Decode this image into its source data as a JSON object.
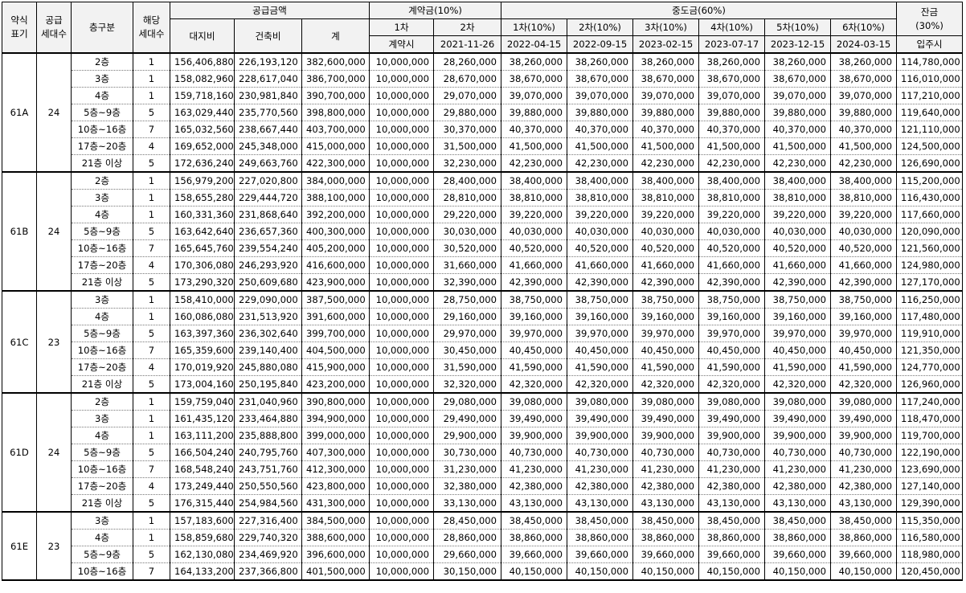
{
  "header": {
    "type_label": "약식\n표기",
    "supply_units_label": "공급\n세대수",
    "floor_label": "층구분",
    "count_label": "해당\n세대수",
    "supply_price_group": "공급금액",
    "land_label": "대지비",
    "building_label": "건축비",
    "total_label": "계",
    "deposit_group": "계약금(10%)",
    "deposit_1": "1차",
    "deposit_2": "2차",
    "deposit_1_date": "계약시",
    "deposit_2_date": "2021-11-26",
    "interim_group": "중도금(60%)",
    "interim": [
      {
        "label": "1차(10%)",
        "date": "2022-04-15"
      },
      {
        "label": "2차(10%)",
        "date": "2022-09-15"
      },
      {
        "label": "3차(10%)",
        "date": "2023-02-15"
      },
      {
        "label": "4차(10%)",
        "date": "2023-07-17"
      },
      {
        "label": "5차(10%)",
        "date": "2023-12-15"
      },
      {
        "label": "6차(10%)",
        "date": "2024-03-15"
      }
    ],
    "balance_label": "잔금\n(30%)",
    "balance_date": "입주시"
  },
  "groups": [
    {
      "type": "61A",
      "units": "24",
      "rows": [
        {
          "floor": "2층",
          "count": "1",
          "land": "156,406,880",
          "building": "226,193,120",
          "total": "382,600,000",
          "dep1": "10,000,000",
          "dep2": "28,260,000",
          "interim": "38,260,000",
          "balance": "114,780,000"
        },
        {
          "floor": "3층",
          "count": "1",
          "land": "158,082,960",
          "building": "228,617,040",
          "total": "386,700,000",
          "dep1": "10,000,000",
          "dep2": "28,670,000",
          "interim": "38,670,000",
          "balance": "116,010,000"
        },
        {
          "floor": "4층",
          "count": "1",
          "land": "159,718,160",
          "building": "230,981,840",
          "total": "390,700,000",
          "dep1": "10,000,000",
          "dep2": "29,070,000",
          "interim": "39,070,000",
          "balance": "117,210,000"
        },
        {
          "floor": "5층~9층",
          "count": "5",
          "land": "163,029,440",
          "building": "235,770,560",
          "total": "398,800,000",
          "dep1": "10,000,000",
          "dep2": "29,880,000",
          "interim": "39,880,000",
          "balance": "119,640,000"
        },
        {
          "floor": "10층~16층",
          "count": "7",
          "land": "165,032,560",
          "building": "238,667,440",
          "total": "403,700,000",
          "dep1": "10,000,000",
          "dep2": "30,370,000",
          "interim": "40,370,000",
          "balance": "121,110,000"
        },
        {
          "floor": "17층~20층",
          "count": "4",
          "land": "169,652,000",
          "building": "245,348,000",
          "total": "415,000,000",
          "dep1": "10,000,000",
          "dep2": "31,500,000",
          "interim": "41,500,000",
          "balance": "124,500,000"
        },
        {
          "floor": "21층 이상",
          "count": "5",
          "land": "172,636,240",
          "building": "249,663,760",
          "total": "422,300,000",
          "dep1": "10,000,000",
          "dep2": "32,230,000",
          "interim": "42,230,000",
          "balance": "126,690,000"
        }
      ]
    },
    {
      "type": "61B",
      "units": "24",
      "rows": [
        {
          "floor": "2층",
          "count": "1",
          "land": "156,979,200",
          "building": "227,020,800",
          "total": "384,000,000",
          "dep1": "10,000,000",
          "dep2": "28,400,000",
          "interim": "38,400,000",
          "balance": "115,200,000"
        },
        {
          "floor": "3층",
          "count": "1",
          "land": "158,655,280",
          "building": "229,444,720",
          "total": "388,100,000",
          "dep1": "10,000,000",
          "dep2": "28,810,000",
          "interim": "38,810,000",
          "balance": "116,430,000"
        },
        {
          "floor": "4층",
          "count": "1",
          "land": "160,331,360",
          "building": "231,868,640",
          "total": "392,200,000",
          "dep1": "10,000,000",
          "dep2": "29,220,000",
          "interim": "39,220,000",
          "balance": "117,660,000"
        },
        {
          "floor": "5층~9층",
          "count": "5",
          "land": "163,642,640",
          "building": "236,657,360",
          "total": "400,300,000",
          "dep1": "10,000,000",
          "dep2": "30,030,000",
          "interim": "40,030,000",
          "balance": "120,090,000"
        },
        {
          "floor": "10층~16층",
          "count": "7",
          "land": "165,645,760",
          "building": "239,554,240",
          "total": "405,200,000",
          "dep1": "10,000,000",
          "dep2": "30,520,000",
          "interim": "40,520,000",
          "balance": "121,560,000"
        },
        {
          "floor": "17층~20층",
          "count": "4",
          "land": "170,306,080",
          "building": "246,293,920",
          "total": "416,600,000",
          "dep1": "10,000,000",
          "dep2": "31,660,000",
          "interim": "41,660,000",
          "balance": "124,980,000"
        },
        {
          "floor": "21층 이상",
          "count": "5",
          "land": "173,290,320",
          "building": "250,609,680",
          "total": "423,900,000",
          "dep1": "10,000,000",
          "dep2": "32,390,000",
          "interim": "42,390,000",
          "balance": "127,170,000"
        }
      ]
    },
    {
      "type": "61C",
      "units": "23",
      "rows": [
        {
          "floor": "3층",
          "count": "1",
          "land": "158,410,000",
          "building": "229,090,000",
          "total": "387,500,000",
          "dep1": "10,000,000",
          "dep2": "28,750,000",
          "interim": "38,750,000",
          "balance": "116,250,000"
        },
        {
          "floor": "4층",
          "count": "1",
          "land": "160,086,080",
          "building": "231,513,920",
          "total": "391,600,000",
          "dep1": "10,000,000",
          "dep2": "29,160,000",
          "interim": "39,160,000",
          "balance": "117,480,000"
        },
        {
          "floor": "5층~9층",
          "count": "5",
          "land": "163,397,360",
          "building": "236,302,640",
          "total": "399,700,000",
          "dep1": "10,000,000",
          "dep2": "29,970,000",
          "interim": "39,970,000",
          "balance": "119,910,000"
        },
        {
          "floor": "10층~16층",
          "count": "7",
          "land": "165,359,600",
          "building": "239,140,400",
          "total": "404,500,000",
          "dep1": "10,000,000",
          "dep2": "30,450,000",
          "interim": "40,450,000",
          "balance": "121,350,000"
        },
        {
          "floor": "17층~20층",
          "count": "4",
          "land": "170,019,920",
          "building": "245,880,080",
          "total": "415,900,000",
          "dep1": "10,000,000",
          "dep2": "31,590,000",
          "interim": "41,590,000",
          "balance": "124,770,000"
        },
        {
          "floor": "21층 이상",
          "count": "5",
          "land": "173,004,160",
          "building": "250,195,840",
          "total": "423,200,000",
          "dep1": "10,000,000",
          "dep2": "32,320,000",
          "interim": "42,320,000",
          "balance": "126,960,000"
        }
      ]
    },
    {
      "type": "61D",
      "units": "24",
      "rows": [
        {
          "floor": "2층",
          "count": "1",
          "land": "159,759,040",
          "building": "231,040,960",
          "total": "390,800,000",
          "dep1": "10,000,000",
          "dep2": "29,080,000",
          "interim": "39,080,000",
          "balance": "117,240,000"
        },
        {
          "floor": "3층",
          "count": "1",
          "land": "161,435,120",
          "building": "233,464,880",
          "total": "394,900,000",
          "dep1": "10,000,000",
          "dep2": "29,490,000",
          "interim": "39,490,000",
          "balance": "118,470,000"
        },
        {
          "floor": "4층",
          "count": "1",
          "land": "163,111,200",
          "building": "235,888,800",
          "total": "399,000,000",
          "dep1": "10,000,000",
          "dep2": "29,900,000",
          "interim": "39,900,000",
          "balance": "119,700,000"
        },
        {
          "floor": "5층~9층",
          "count": "5",
          "land": "166,504,240",
          "building": "240,795,760",
          "total": "407,300,000",
          "dep1": "10,000,000",
          "dep2": "30,730,000",
          "interim": "40,730,000",
          "balance": "122,190,000"
        },
        {
          "floor": "10층~16층",
          "count": "7",
          "land": "168,548,240",
          "building": "243,751,760",
          "total": "412,300,000",
          "dep1": "10,000,000",
          "dep2": "31,230,000",
          "interim": "41,230,000",
          "balance": "123,690,000"
        },
        {
          "floor": "17층~20층",
          "count": "4",
          "land": "173,249,440",
          "building": "250,550,560",
          "total": "423,800,000",
          "dep1": "10,000,000",
          "dep2": "32,380,000",
          "interim": "42,380,000",
          "balance": "127,140,000"
        },
        {
          "floor": "21층 이상",
          "count": "5",
          "land": "176,315,440",
          "building": "254,984,560",
          "total": "431,300,000",
          "dep1": "10,000,000",
          "dep2": "33,130,000",
          "interim": "43,130,000",
          "balance": "129,390,000"
        }
      ]
    },
    {
      "type": "61E",
      "units": "23",
      "rows": [
        {
          "floor": "3층",
          "count": "1",
          "land": "157,183,600",
          "building": "227,316,400",
          "total": "384,500,000",
          "dep1": "10,000,000",
          "dep2": "28,450,000",
          "interim": "38,450,000",
          "balance": "115,350,000"
        },
        {
          "floor": "4층",
          "count": "1",
          "land": "158,859,680",
          "building": "229,740,320",
          "total": "388,600,000",
          "dep1": "10,000,000",
          "dep2": "28,860,000",
          "interim": "38,860,000",
          "balance": "116,580,000"
        },
        {
          "floor": "5층~9층",
          "count": "5",
          "land": "162,130,080",
          "building": "234,469,920",
          "total": "396,600,000",
          "dep1": "10,000,000",
          "dep2": "29,660,000",
          "interim": "39,660,000",
          "balance": "118,980,000"
        },
        {
          "floor": "10층~16층",
          "count": "7",
          "land": "164,133,200",
          "building": "237,366,800",
          "total": "401,500,000",
          "dep1": "10,000,000",
          "dep2": "30,150,000",
          "interim": "40,150,000",
          "balance": "120,450,000"
        }
      ]
    }
  ]
}
